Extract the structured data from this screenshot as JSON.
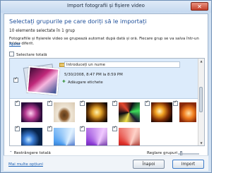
{
  "window": {
    "title": "Import fotografii și fișiere video",
    "close_glyph": "✕"
  },
  "header": {
    "heading": "Selectați grupurile pe care doriți să le importați",
    "count": "10 elemente selectate în 1 grup",
    "description": "Fotografiile și fișierele video se grupează automat după dată și oră. Fiecare grup se va salva într-un folder diferit.",
    "help_link": "Ajutor"
  },
  "select_all": {
    "label": "Selectare totală",
    "checked": false
  },
  "group": {
    "checked": true,
    "name_placeholder": "Introduceți un nume",
    "date_range": "5/30/2008, 8:47 PM la 8:59 PM",
    "add_tags": "Adăugare etichete",
    "folder_icon": "folder-icon",
    "tag_icon": "tag-icon"
  },
  "thumbnails": [
    {
      "checked": true,
      "style": "violet-swirl"
    },
    {
      "checked": true,
      "style": "coffee-cup"
    },
    {
      "checked": true,
      "style": "gold-swirl"
    },
    {
      "checked": true,
      "style": "rainbow-fractal"
    },
    {
      "checked": true,
      "style": "amber-fractal"
    },
    {
      "checked": true,
      "style": "orange-swirl"
    },
    {
      "checked": true,
      "style": "blue-spheres"
    },
    {
      "checked": true,
      "style": "blue-fan"
    },
    {
      "checked": true,
      "style": "violet-fan"
    },
    {
      "checked": true,
      "style": "red-fan"
    }
  ],
  "controls": {
    "collapse_all": "Restrângere totală",
    "adjust_groups": "Reglare grupuri",
    "adjust_level": 0.1
  },
  "footer": {
    "more_options": "Mai multe opțiuni",
    "back": "Înapoi",
    "import": "Import"
  },
  "colors": {
    "heading": "#1e4f9a",
    "link": "#1a5fb4",
    "group_bg": "#dcebfb"
  }
}
